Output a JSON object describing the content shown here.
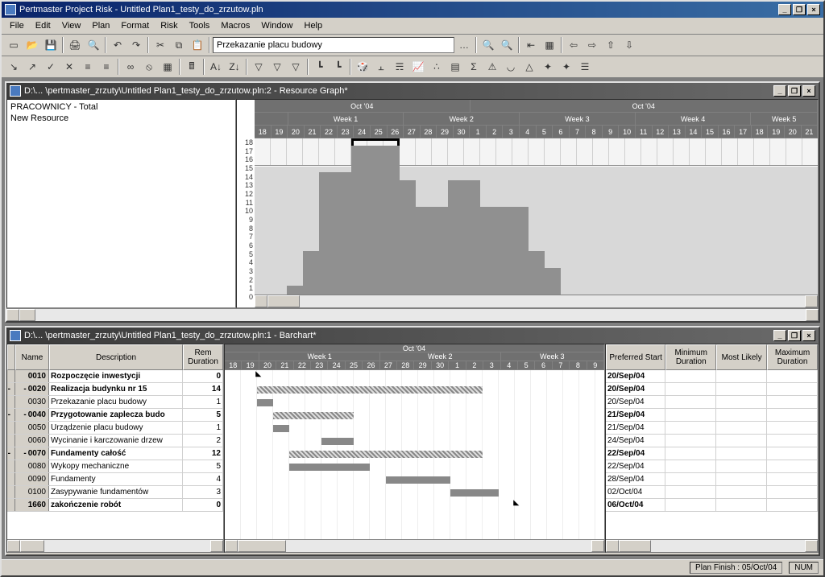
{
  "app": {
    "title": "Pertmaster Project Risk - Untitled Plan1_testy_do_zrzutow.pln",
    "search_value": "Przekazanie placu budowy"
  },
  "menu": [
    "File",
    "Edit",
    "View",
    "Plan",
    "Format",
    "Risk",
    "Tools",
    "Macros",
    "Window",
    "Help"
  ],
  "winbuttons": {
    "min": "_",
    "max": "❐",
    "close": "×"
  },
  "child1": {
    "title": "D:\\... \\pertmaster_zrzuty\\Untitled Plan1_testy_do_zrzutow.pln:2 - Resource Graph*",
    "left_items": [
      "PRACOWNICY - Total",
      "New Resource"
    ]
  },
  "timeline": {
    "months": [
      "Oct '04",
      "Oct '04"
    ],
    "weeks": [
      "Week 1",
      "Week 2",
      "Week 3",
      "Week 4",
      "Week 5"
    ],
    "days": [
      "18",
      "19",
      "20",
      "21",
      "22",
      "23",
      "24",
      "25",
      "26",
      "27",
      "28",
      "29",
      "30",
      "1",
      "2",
      "3",
      "4",
      "5",
      "6",
      "7",
      "8",
      "9",
      "10",
      "11",
      "12",
      "13",
      "14",
      "15",
      "16",
      "17",
      "18",
      "19",
      "20",
      "21"
    ]
  },
  "yscale": [
    "18",
    "17",
    "16",
    "15",
    "14",
    "13",
    "12",
    "11",
    "10",
    "9",
    "8",
    "7",
    "6",
    "5",
    "4",
    "3",
    "2",
    "1",
    "0"
  ],
  "child2": {
    "title": "D:\\... \\pertmaster_zrzuty\\Untitled Plan1_testy_do_zrzutow.pln:1 - Barchart*"
  },
  "grid": {
    "headers": {
      "name": "Name",
      "desc": "Description",
      "rem": "Rem Duration"
    },
    "extras": {
      "pref": "Preferred Start",
      "min": "Minimum Duration",
      "most": "Most Likely",
      "max": "Maximum Duration"
    },
    "rows": [
      {
        "id": "0010",
        "desc": "Rozpoczęcie inwestycji",
        "rem": "0",
        "bold": true,
        "start": "20/Sep/04"
      },
      {
        "id": "0020",
        "desc": "Realizacja budynku nr 15",
        "rem": "14",
        "bold": true,
        "exp": true,
        "start": "20/Sep/04"
      },
      {
        "id": "0030",
        "desc": "Przekazanie placu budowy",
        "rem": "1",
        "start": "20/Sep/04"
      },
      {
        "id": "0040",
        "desc": "Przygotowanie zaplecza budo",
        "rem": "5",
        "bold": true,
        "exp": true,
        "start": "21/Sep/04"
      },
      {
        "id": "0050",
        "desc": "Urządzenie placu budowy",
        "rem": "1",
        "start": "21/Sep/04"
      },
      {
        "id": "0060",
        "desc": "Wycinanie i karczowanie drzew",
        "rem": "2",
        "start": "24/Sep/04"
      },
      {
        "id": "0070",
        "desc": "Fundamenty całość",
        "rem": "12",
        "bold": true,
        "exp": true,
        "start": "22/Sep/04"
      },
      {
        "id": "0080",
        "desc": "Wykopy mechaniczne",
        "rem": "5",
        "start": "22/Sep/04"
      },
      {
        "id": "0090",
        "desc": "Fundamenty",
        "rem": "4",
        "start": "28/Sep/04"
      },
      {
        "id": "0100",
        "desc": "Zasypywanie fundamentów",
        "rem": "3",
        "start": "02/Oct/04"
      },
      {
        "id": "1660",
        "desc": "zakończenie robót",
        "rem": "0",
        "bold": true,
        "start": "06/Oct/04"
      }
    ]
  },
  "chart_data": {
    "type": "bar",
    "title": "PRACOWNICY - Total",
    "xlabel": "",
    "ylabel": "",
    "ylim": [
      0,
      18
    ],
    "limit_line": 15,
    "categories": [
      "18",
      "19",
      "20",
      "21",
      "22",
      "23",
      "24",
      "25",
      "26",
      "27",
      "28",
      "29",
      "30",
      "1",
      "2",
      "3",
      "4",
      "5",
      "6",
      "7",
      "8",
      "9"
    ],
    "values": [
      0,
      0,
      1,
      5,
      14,
      14,
      17,
      17,
      17,
      13,
      10,
      10,
      13,
      13,
      10,
      10,
      10,
      5,
      3,
      0,
      0,
      0
    ]
  },
  "statusbar": {
    "planfinish": "Plan Finish : 05/Oct/04",
    "num": "NUM"
  },
  "timeline2": {
    "weeks": [
      "Week 1",
      "Week 2",
      "Week 3"
    ],
    "days": [
      "18",
      "19",
      "20",
      "21",
      "22",
      "23",
      "24",
      "25",
      "26",
      "27",
      "28",
      "29",
      "30",
      "1",
      "2",
      "3",
      "4",
      "5",
      "6",
      "7",
      "8",
      "9"
    ]
  }
}
